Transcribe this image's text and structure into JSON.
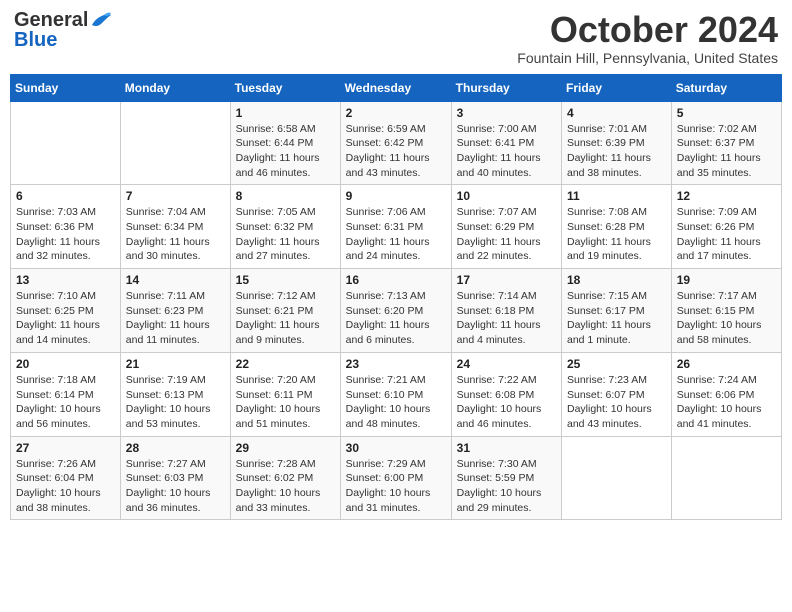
{
  "logo": {
    "general": "General",
    "blue": "Blue"
  },
  "header": {
    "month": "October 2024",
    "location": "Fountain Hill, Pennsylvania, United States"
  },
  "days_of_week": [
    "Sunday",
    "Monday",
    "Tuesday",
    "Wednesday",
    "Thursday",
    "Friday",
    "Saturday"
  ],
  "weeks": [
    [
      {
        "day": "",
        "info": ""
      },
      {
        "day": "",
        "info": ""
      },
      {
        "day": "1",
        "info": "Sunrise: 6:58 AM\nSunset: 6:44 PM\nDaylight: 11 hours and 46 minutes."
      },
      {
        "day": "2",
        "info": "Sunrise: 6:59 AM\nSunset: 6:42 PM\nDaylight: 11 hours and 43 minutes."
      },
      {
        "day": "3",
        "info": "Sunrise: 7:00 AM\nSunset: 6:41 PM\nDaylight: 11 hours and 40 minutes."
      },
      {
        "day": "4",
        "info": "Sunrise: 7:01 AM\nSunset: 6:39 PM\nDaylight: 11 hours and 38 minutes."
      },
      {
        "day": "5",
        "info": "Sunrise: 7:02 AM\nSunset: 6:37 PM\nDaylight: 11 hours and 35 minutes."
      }
    ],
    [
      {
        "day": "6",
        "info": "Sunrise: 7:03 AM\nSunset: 6:36 PM\nDaylight: 11 hours and 32 minutes."
      },
      {
        "day": "7",
        "info": "Sunrise: 7:04 AM\nSunset: 6:34 PM\nDaylight: 11 hours and 30 minutes."
      },
      {
        "day": "8",
        "info": "Sunrise: 7:05 AM\nSunset: 6:32 PM\nDaylight: 11 hours and 27 minutes."
      },
      {
        "day": "9",
        "info": "Sunrise: 7:06 AM\nSunset: 6:31 PM\nDaylight: 11 hours and 24 minutes."
      },
      {
        "day": "10",
        "info": "Sunrise: 7:07 AM\nSunset: 6:29 PM\nDaylight: 11 hours and 22 minutes."
      },
      {
        "day": "11",
        "info": "Sunrise: 7:08 AM\nSunset: 6:28 PM\nDaylight: 11 hours and 19 minutes."
      },
      {
        "day": "12",
        "info": "Sunrise: 7:09 AM\nSunset: 6:26 PM\nDaylight: 11 hours and 17 minutes."
      }
    ],
    [
      {
        "day": "13",
        "info": "Sunrise: 7:10 AM\nSunset: 6:25 PM\nDaylight: 11 hours and 14 minutes."
      },
      {
        "day": "14",
        "info": "Sunrise: 7:11 AM\nSunset: 6:23 PM\nDaylight: 11 hours and 11 minutes."
      },
      {
        "day": "15",
        "info": "Sunrise: 7:12 AM\nSunset: 6:21 PM\nDaylight: 11 hours and 9 minutes."
      },
      {
        "day": "16",
        "info": "Sunrise: 7:13 AM\nSunset: 6:20 PM\nDaylight: 11 hours and 6 minutes."
      },
      {
        "day": "17",
        "info": "Sunrise: 7:14 AM\nSunset: 6:18 PM\nDaylight: 11 hours and 4 minutes."
      },
      {
        "day": "18",
        "info": "Sunrise: 7:15 AM\nSunset: 6:17 PM\nDaylight: 11 hours and 1 minute."
      },
      {
        "day": "19",
        "info": "Sunrise: 7:17 AM\nSunset: 6:15 PM\nDaylight: 10 hours and 58 minutes."
      }
    ],
    [
      {
        "day": "20",
        "info": "Sunrise: 7:18 AM\nSunset: 6:14 PM\nDaylight: 10 hours and 56 minutes."
      },
      {
        "day": "21",
        "info": "Sunrise: 7:19 AM\nSunset: 6:13 PM\nDaylight: 10 hours and 53 minutes."
      },
      {
        "day": "22",
        "info": "Sunrise: 7:20 AM\nSunset: 6:11 PM\nDaylight: 10 hours and 51 minutes."
      },
      {
        "day": "23",
        "info": "Sunrise: 7:21 AM\nSunset: 6:10 PM\nDaylight: 10 hours and 48 minutes."
      },
      {
        "day": "24",
        "info": "Sunrise: 7:22 AM\nSunset: 6:08 PM\nDaylight: 10 hours and 46 minutes."
      },
      {
        "day": "25",
        "info": "Sunrise: 7:23 AM\nSunset: 6:07 PM\nDaylight: 10 hours and 43 minutes."
      },
      {
        "day": "26",
        "info": "Sunrise: 7:24 AM\nSunset: 6:06 PM\nDaylight: 10 hours and 41 minutes."
      }
    ],
    [
      {
        "day": "27",
        "info": "Sunrise: 7:26 AM\nSunset: 6:04 PM\nDaylight: 10 hours and 38 minutes."
      },
      {
        "day": "28",
        "info": "Sunrise: 7:27 AM\nSunset: 6:03 PM\nDaylight: 10 hours and 36 minutes."
      },
      {
        "day": "29",
        "info": "Sunrise: 7:28 AM\nSunset: 6:02 PM\nDaylight: 10 hours and 33 minutes."
      },
      {
        "day": "30",
        "info": "Sunrise: 7:29 AM\nSunset: 6:00 PM\nDaylight: 10 hours and 31 minutes."
      },
      {
        "day": "31",
        "info": "Sunrise: 7:30 AM\nSunset: 5:59 PM\nDaylight: 10 hours and 29 minutes."
      },
      {
        "day": "",
        "info": ""
      },
      {
        "day": "",
        "info": ""
      }
    ]
  ]
}
